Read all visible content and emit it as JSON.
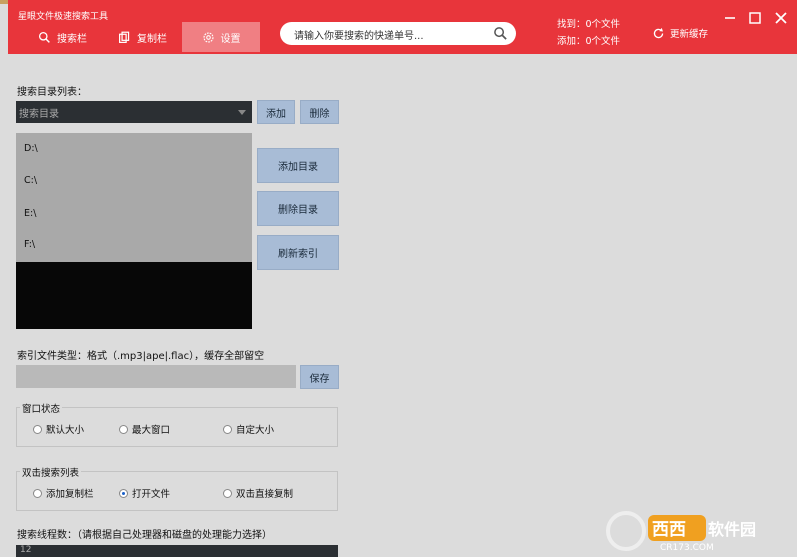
{
  "window": {
    "title": "星眼文件极速搜索工具"
  },
  "tabs": [
    {
      "label": "搜索栏",
      "icon": "search-icon"
    },
    {
      "label": "复制栏",
      "icon": "copy-icon"
    },
    {
      "label": "设置",
      "icon": "gear-icon"
    }
  ],
  "search": {
    "placeholder": "请输入你要搜索的快递单号..."
  },
  "stats": {
    "found": "找到：0个文件",
    "added": "添加：0个文件"
  },
  "refresh_label": "更新缓存",
  "colors": {
    "header": "#e8353b",
    "active_tab": "#f07f83",
    "button": "#a8bcd6"
  },
  "settings": {
    "dir_list_label": "搜索目录列表：",
    "dir_select_value": "搜索目录",
    "add_btn": "添加",
    "delete_btn": "删除",
    "directories": [
      "D:\\",
      "C:\\",
      "E:\\",
      "F:\\"
    ],
    "add_dir_btn": "添加目录",
    "delete_dir_btn": "删除目录",
    "refresh_index_btn": "刷新索引",
    "file_type_label": "索引文件类型：格式（.mp3|ape|.flac），缓存全部留空",
    "save_btn": "保存",
    "window_state": {
      "title": "窗口状态",
      "options": [
        "默认大小",
        "最大窗口",
        "自定大小"
      ],
      "selected": ""
    },
    "double_click": {
      "title": "双击搜索列表",
      "options": [
        "添加复制栏",
        "打开文件",
        "双击直接复制"
      ],
      "selected": "打开文件"
    },
    "threads_label": "搜索线程数：（请根据自己处理器和磁盘的处理能力选择）",
    "threads_value": "12"
  },
  "watermark": {
    "brand": "西西软件园",
    "url": "CR173.COM"
  }
}
